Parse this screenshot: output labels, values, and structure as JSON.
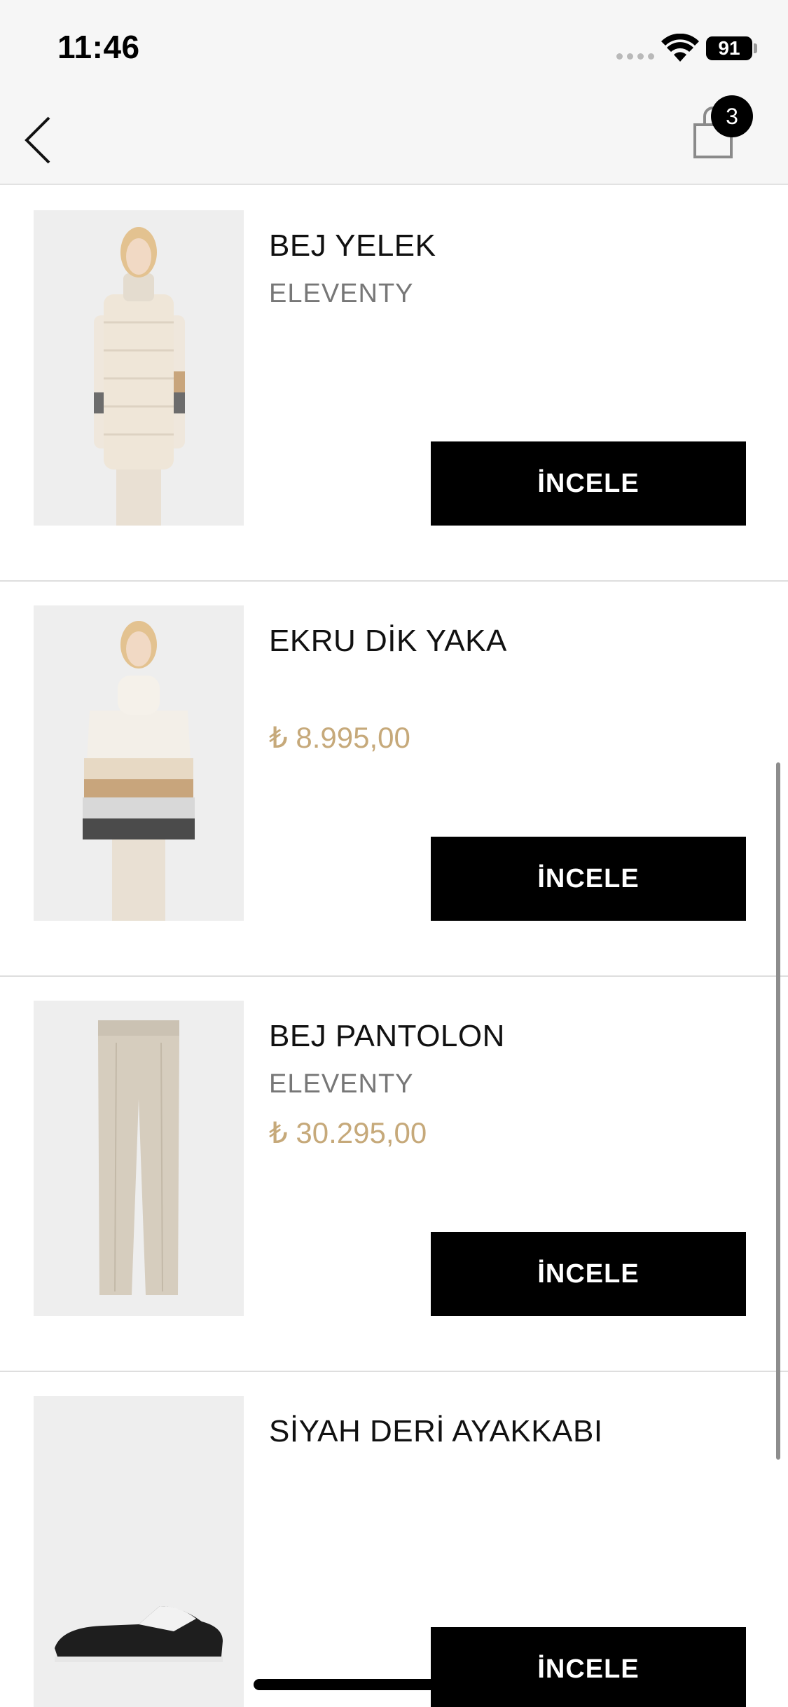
{
  "status_bar": {
    "time": "11:46",
    "battery": "91"
  },
  "header": {
    "cart_count": "3"
  },
  "products": [
    {
      "name": "BEJ YELEK",
      "brand": "ELEVENTY",
      "price": "",
      "button": "İNCELE"
    },
    {
      "name": "EKRU DİK YAKA",
      "brand": "",
      "price": "₺ 8.995,00",
      "button": "İNCELE"
    },
    {
      "name": "BEJ PANTOLON",
      "brand": "ELEVENTY",
      "price": "₺ 30.295,00",
      "button": "İNCELE"
    },
    {
      "name": "SİYAH DERİ AYAKKABI",
      "brand": "",
      "price": "",
      "button": "İNCELE"
    }
  ],
  "colors": {
    "price": "#c6a97a",
    "button_bg": "#000000",
    "brand": "#777777"
  },
  "icons": [
    "back-arrow-icon",
    "shopping-bag-icon",
    "wifi-icon",
    "battery-icon"
  ]
}
